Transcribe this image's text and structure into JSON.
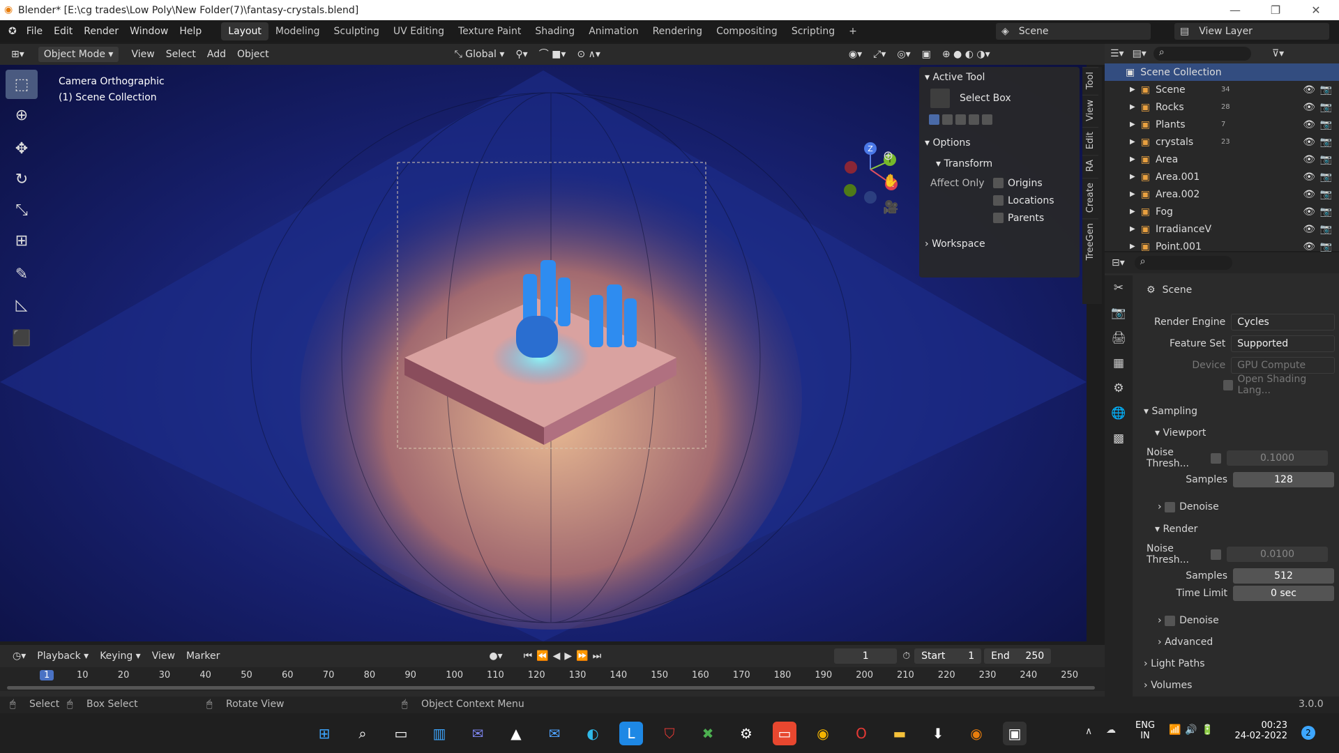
{
  "titlebar": {
    "title": "Blender* [E:\\cg trades\\Low Poly\\New Folder(7)\\fantasy-crystals.blend]",
    "minimize": "—",
    "maximize": "❐",
    "close": "✕"
  },
  "menubar": [
    "File",
    "Edit",
    "Render",
    "Window",
    "Help"
  ],
  "workspaces": [
    "Layout",
    "Modeling",
    "Sculpting",
    "UV Editing",
    "Texture Paint",
    "Shading",
    "Animation",
    "Rendering",
    "Compositing",
    "Scripting"
  ],
  "scene_selector": "Scene",
  "view_layer": "View Layer",
  "header3d": {
    "mode": "Object Mode",
    "view": "View",
    "select": "Select",
    "add": "Add",
    "object": "Object",
    "orientation": "Global"
  },
  "viewport": {
    "line1": "Camera Orthographic",
    "line2": "(1) Scene Collection"
  },
  "gizmo": {
    "z": "Z",
    "y": "Y",
    "x": "X"
  },
  "npanel": {
    "active_tool": "Active Tool",
    "tool_name": "Select Box",
    "options": "Options",
    "transform": "Transform",
    "affect_only": "Affect Only",
    "origins": "Origins",
    "locations": "Locations",
    "parents": "Parents",
    "workspace": "Workspace"
  },
  "side_tabs": [
    "Tool",
    "View",
    "Edit",
    "RA",
    "Create",
    "TreeGen"
  ],
  "outliner": {
    "root": "Scene Collection",
    "items": [
      {
        "name": "Scene",
        "badge": "34"
      },
      {
        "name": "Rocks",
        "badge": "28"
      },
      {
        "name": "Plants",
        "badge": "7"
      },
      {
        "name": "crystals",
        "badge": "23"
      },
      {
        "name": "Area",
        "badge": ""
      },
      {
        "name": "Area.001",
        "badge": ""
      },
      {
        "name": "Area.002",
        "badge": ""
      },
      {
        "name": "Fog",
        "badge": ""
      },
      {
        "name": "IrradianceVolume",
        "badge": ""
      },
      {
        "name": "Point.001",
        "badge": ""
      }
    ]
  },
  "properties": {
    "scene": "Scene",
    "render_engine_label": "Render Engine",
    "render_engine": "Cycles",
    "feature_set_label": "Feature Set",
    "feature_set": "Supported",
    "device_label": "Device",
    "device": "GPU Compute",
    "osl": "Open Shading Lang...",
    "sampling": "Sampling",
    "viewport": "Viewport",
    "noise_thresh": "Noise Thresh...",
    "vp_noise": "0.1000",
    "samples": "Samples",
    "vp_samples": "128",
    "denoise": "Denoise",
    "render": "Render",
    "r_noise": "0.0100",
    "r_samples": "512",
    "time_limit": "Time Limit",
    "time_limit_val": "0 sec",
    "advanced": "Advanced",
    "light_paths": "Light Paths",
    "volumes": "Volumes",
    "version": "3.0.0"
  },
  "timeline": {
    "playback": "Playback",
    "keying": "Keying",
    "view": "View",
    "marker": "Marker",
    "current": "1",
    "start_label": "Start",
    "start": "1",
    "end_label": "End",
    "end": "250",
    "ticks": [
      "1",
      "10",
      "20",
      "30",
      "40",
      "50",
      "60",
      "70",
      "80",
      "90",
      "100",
      "110",
      "120",
      "130",
      "140",
      "150",
      "160",
      "170",
      "180",
      "190",
      "200",
      "210",
      "220",
      "230",
      "240",
      "250"
    ]
  },
  "statusbar": {
    "select": "Select",
    "box_select": "Box Select",
    "rotate": "Rotate View",
    "context": "Object Context Menu"
  },
  "taskbar": {
    "lang1": "ENG",
    "lang2": "IN",
    "time": "00:23",
    "date": "24-02-2022",
    "notif": "2"
  }
}
